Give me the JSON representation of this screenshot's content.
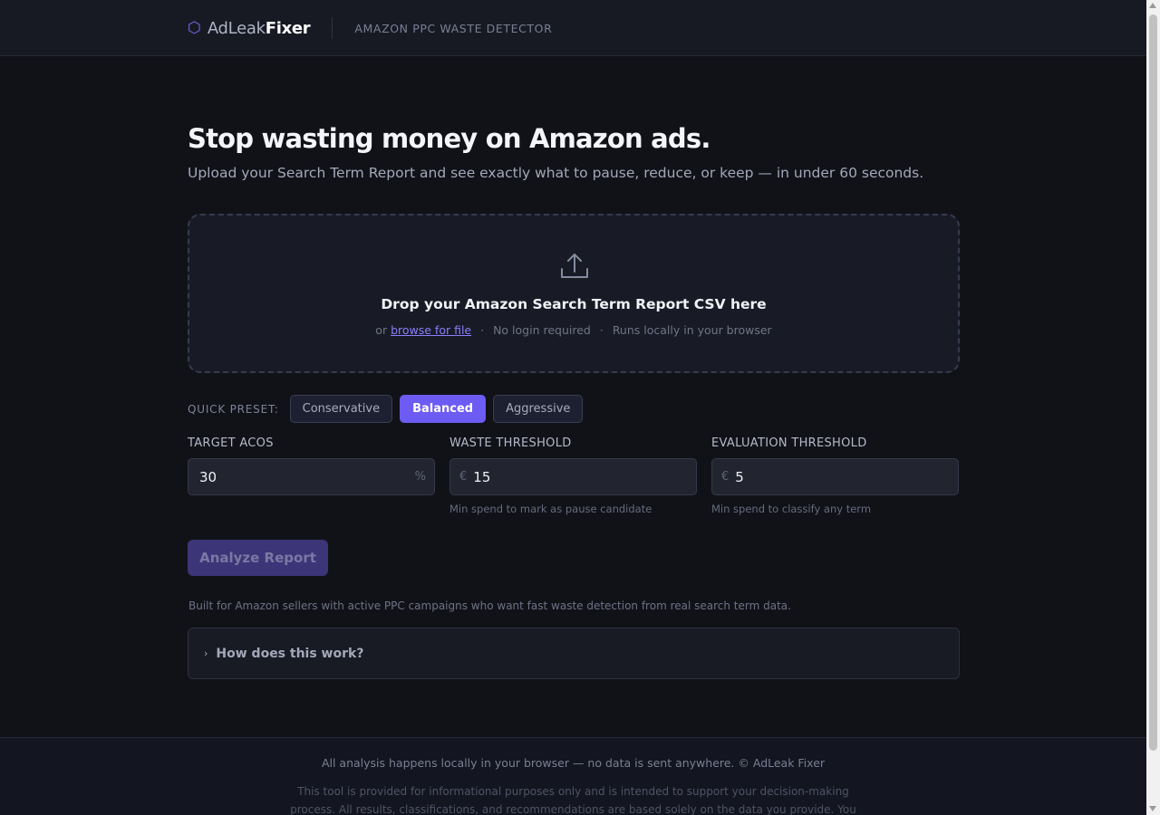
{
  "header": {
    "brand_icon": "hexagon-icon",
    "brand_light": "AdLeak",
    "brand_bold": "Fixer",
    "tagline": "AMAZON PPC WASTE DETECTOR"
  },
  "hero": {
    "title": "Stop wasting money on Amazon ads.",
    "subtitle": "Upload your Search Term Report and see exactly what to pause, reduce, or keep — in under 60 seconds."
  },
  "dropzone": {
    "icon": "upload-icon",
    "title": "Drop your Amazon Search Term Report CSV here",
    "or_text": "or",
    "browse_link": "browse for file",
    "separator": "·",
    "note_1": "No login required",
    "note_2": "Runs locally in your browser"
  },
  "presets": {
    "label": "QUICK PRESET:",
    "options": [
      "Conservative",
      "Balanced",
      "Aggressive"
    ],
    "selected": "Balanced"
  },
  "fields": {
    "target_acos": {
      "label": "TARGET ACOS",
      "value": "30",
      "suffix": "%"
    },
    "waste_threshold": {
      "label": "WASTE THRESHOLD",
      "prefix": "€",
      "value": "15",
      "help": "Min spend to mark as pause candidate"
    },
    "evaluation_threshold": {
      "label": "EVALUATION THRESHOLD",
      "prefix": "€",
      "value": "5",
      "help": "Min spend to classify any term"
    }
  },
  "analyze_button": {
    "label": "Analyze Report",
    "state": "disabled"
  },
  "built_for": "Built for Amazon sellers with active PPC campaigns who want fast waste detection from real search term data.",
  "faq": {
    "label": "How does this work?",
    "icon": "chevron-right-icon"
  },
  "footer": {
    "main": "All analysis happens locally in your browser — no data is sent anywhere. © AdLeak Fixer",
    "legal": "This tool is provided for informational purposes only and is intended to support your decision-making process. All results, classifications, and recommendations are based solely on the data you provide. You remain fully responsible"
  },
  "colors": {
    "background": "#111218",
    "accent": "#6c5cf3",
    "accent_disabled": "#3c3577",
    "link": "#8c7dff"
  }
}
